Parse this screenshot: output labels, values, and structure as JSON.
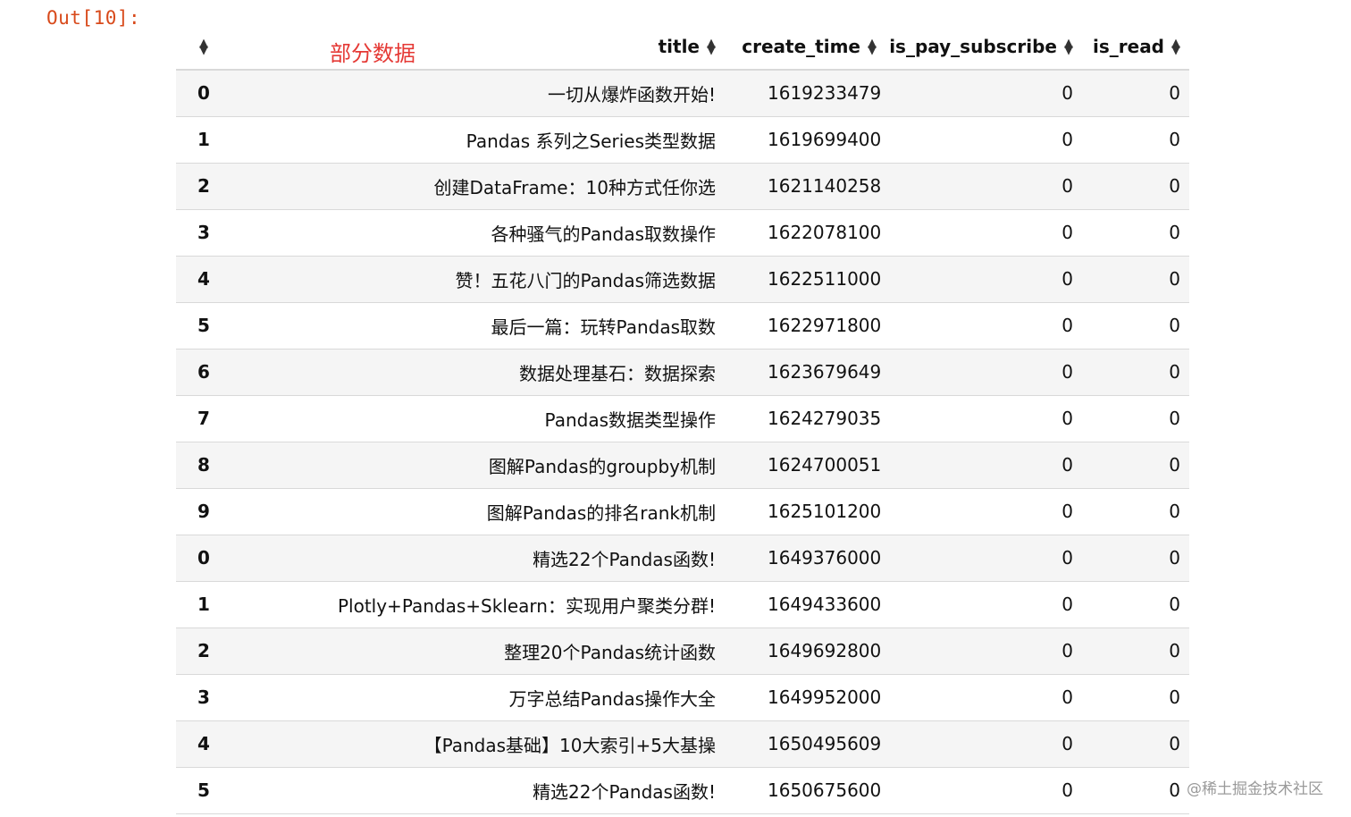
{
  "prompt": "Out[10]:",
  "annotation": "部分数据",
  "watermark": "@稀土掘金技术社区",
  "columns": [
    "title",
    "create_time",
    "is_pay_subscribe",
    "is_read"
  ],
  "rows": [
    {
      "index": "0",
      "title": "一切从爆炸函数开始!",
      "create_time": "1619233479",
      "is_pay_subscribe": "0",
      "is_read": "0"
    },
    {
      "index": "1",
      "title": "Pandas 系列之Series类型数据",
      "create_time": "1619699400",
      "is_pay_subscribe": "0",
      "is_read": "0"
    },
    {
      "index": "2",
      "title": "创建DataFrame：10种方式任你选",
      "create_time": "1621140258",
      "is_pay_subscribe": "0",
      "is_read": "0"
    },
    {
      "index": "3",
      "title": "各种骚气的Pandas取数操作",
      "create_time": "1622078100",
      "is_pay_subscribe": "0",
      "is_read": "0"
    },
    {
      "index": "4",
      "title": "赞！五花八门的Pandas筛选数据",
      "create_time": "1622511000",
      "is_pay_subscribe": "0",
      "is_read": "0"
    },
    {
      "index": "5",
      "title": "最后一篇：玩转Pandas取数",
      "create_time": "1622971800",
      "is_pay_subscribe": "0",
      "is_read": "0"
    },
    {
      "index": "6",
      "title": "数据处理基石：数据探索",
      "create_time": "1623679649",
      "is_pay_subscribe": "0",
      "is_read": "0"
    },
    {
      "index": "7",
      "title": "Pandas数据类型操作",
      "create_time": "1624279035",
      "is_pay_subscribe": "0",
      "is_read": "0"
    },
    {
      "index": "8",
      "title": "图解Pandas的groupby机制",
      "create_time": "1624700051",
      "is_pay_subscribe": "0",
      "is_read": "0"
    },
    {
      "index": "9",
      "title": "图解Pandas的排名rank机制",
      "create_time": "1625101200",
      "is_pay_subscribe": "0",
      "is_read": "0"
    },
    {
      "index": "0",
      "title": "精选22个Pandas函数!",
      "create_time": "1649376000",
      "is_pay_subscribe": "0",
      "is_read": "0"
    },
    {
      "index": "1",
      "title": "Plotly+Pandas+Sklearn：实现用户聚类分群!",
      "create_time": "1649433600",
      "is_pay_subscribe": "0",
      "is_read": "0"
    },
    {
      "index": "2",
      "title": "整理20个Pandas统计函数",
      "create_time": "1649692800",
      "is_pay_subscribe": "0",
      "is_read": "0"
    },
    {
      "index": "3",
      "title": "万字总结Pandas操作大全",
      "create_time": "1649952000",
      "is_pay_subscribe": "0",
      "is_read": "0"
    },
    {
      "index": "4",
      "title": "【Pandas基础】10大索引+5大基操",
      "create_time": "1650495609",
      "is_pay_subscribe": "0",
      "is_read": "0"
    },
    {
      "index": "5",
      "title": "精选22个Pandas函数!",
      "create_time": "1650675600",
      "is_pay_subscribe": "0",
      "is_read": "0"
    }
  ]
}
